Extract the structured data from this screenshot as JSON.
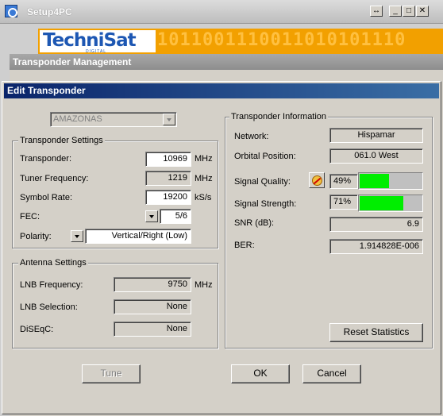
{
  "main_window": {
    "title": "Setup4PC",
    "controls": {
      "restore": "↔",
      "minimize": "_",
      "maximize": "□",
      "close": "✕"
    },
    "banner": {
      "logo_text": "TechniSat",
      "logo_sub": "DIGITAL",
      "binary_text": "1011001110011010101110"
    }
  },
  "transponder_management": {
    "title": "Transponder Management"
  },
  "dialog": {
    "title": "Edit Transponder",
    "satellite_select": {
      "value": "AMAZONAS"
    },
    "transponder_settings": {
      "legend": "Transponder Settings",
      "transponder": {
        "label": "Transponder:",
        "value": "10969",
        "unit": "MHz"
      },
      "tuner_frequency": {
        "label": "Tuner Frequency:",
        "value": "1219",
        "unit": "MHz"
      },
      "symbol_rate": {
        "label": "Symbol Rate:",
        "value": "19200",
        "unit": "kS/s"
      },
      "fec": {
        "label": "FEC:",
        "value": "5/6"
      },
      "polarity": {
        "label": "Polarity:",
        "value": "Vertical/Right (Low)"
      }
    },
    "antenna_settings": {
      "legend": "Antenna Settings",
      "lnb_frequency": {
        "label": "LNB Frequency:",
        "value": "9750",
        "unit": "MHz"
      },
      "lnb_selection": {
        "label": "LNB Selection:",
        "value": "None"
      },
      "diseqc": {
        "label": "DiSEqC:",
        "value": "None"
      }
    },
    "transponder_information": {
      "legend": "Transponder Information",
      "network": {
        "label": "Network:",
        "value": "Hispamar"
      },
      "orbital_position": {
        "label": "Orbital Position:",
        "value": "061.0 West"
      },
      "signal_quality": {
        "label": "Signal Quality:",
        "value": "49%",
        "level": 0.49
      },
      "signal_strength": {
        "label": "Signal Strength:",
        "value": "71%",
        "level": 0.71
      },
      "snr": {
        "label": "SNR (dB):",
        "value": "6.9"
      },
      "ber": {
        "label": "BER:",
        "value": "1.914828E-006"
      },
      "reset_button": "Reset Statistics"
    },
    "buttons": {
      "tune": "Tune",
      "ok": "OK",
      "cancel": "Cancel"
    }
  },
  "colors": {
    "dialog_title_start": "#0a246a",
    "dialog_title_end": "#3a6ea5",
    "signal_bar": "#00ee00",
    "banner": "#f2a000",
    "logo": "#1d57b3"
  },
  "icons": {
    "signal_quality_icon": "satellite-dish-icon"
  }
}
